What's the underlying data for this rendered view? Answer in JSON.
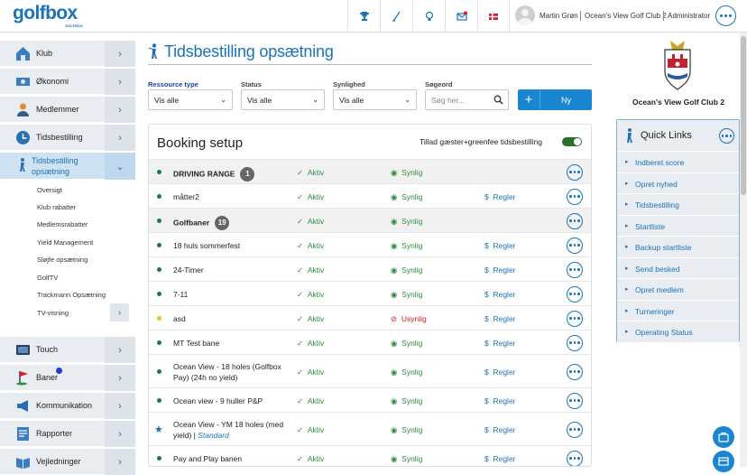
{
  "brand": {
    "logo_text": "golfbox",
    "logo_sub": "GOLFBOX"
  },
  "topbar": {
    "user_name": "Martin Grøn",
    "club": "Ocean's View Golf Club 2",
    "role": "Administrator",
    "icons": [
      "trophy-icon",
      "golf-club-icon",
      "lightbulb-icon",
      "mail-icon",
      "flag-dk-icon"
    ]
  },
  "sidebar": {
    "items": [
      {
        "label": "Klub",
        "icon": "house-icon"
      },
      {
        "label": "Økonomi",
        "icon": "money-icon"
      },
      {
        "label": "Medlemmer",
        "icon": "members-icon"
      },
      {
        "label": "Tidsbestilling",
        "icon": "clock-icon"
      },
      {
        "label": "Tidsbestilling opsætning",
        "icon": "golfer-icon"
      },
      {
        "label": "Touch",
        "icon": "touch-icon"
      },
      {
        "label": "Baner",
        "icon": "flag-icon"
      },
      {
        "label": "Kommunikation",
        "icon": "megaphone-icon"
      },
      {
        "label": "Rapporter",
        "icon": "report-icon"
      },
      {
        "label": "Vejledninger",
        "icon": "guide-icon"
      }
    ],
    "subitems": [
      "Oversigt",
      "Klub rabatter",
      "Medlemsrabatter",
      "Yield Management",
      "Sløjfe opsætning",
      "GolfTV",
      "Trackmann Opsætning",
      "TV-visning"
    ]
  },
  "page": {
    "title": "Tidsbestilling opsætning"
  },
  "filters": {
    "resource_label": "Ressource type",
    "resource_value": "Vis alle",
    "status_label": "Status",
    "status_value": "Vis alle",
    "visibility_label": "Synlighed",
    "visibility_value": "Vis alle",
    "search_label": "Søgeord",
    "search_placeholder": "Søg her...",
    "new_label": "Ny"
  },
  "panel": {
    "title": "Booking setup",
    "toggle_label": "Tillad gæster+greenfee tidsbestilling",
    "toggle_on": true
  },
  "rows": [
    {
      "name": "DRIVING RANGE",
      "count": "1",
      "group": true,
      "status": "Aktiv",
      "visibility": "Synlig",
      "rules": "",
      "marker": "green"
    },
    {
      "name": "måtter2",
      "group": false,
      "status": "Aktiv",
      "visibility": "Synlig",
      "rules": "Regler",
      "marker": "green"
    },
    {
      "name": "Golfbaner",
      "count": "19",
      "group": true,
      "status": "Aktiv",
      "visibility": "Synlig",
      "rules": "",
      "marker": "green"
    },
    {
      "name": "18 huls sommerfest",
      "group": false,
      "status": "Aktiv",
      "visibility": "Synlig",
      "rules": "Regler",
      "marker": "green"
    },
    {
      "name": "24-Timer",
      "group": false,
      "status": "Aktiv",
      "visibility": "Synlig",
      "rules": "Regler",
      "marker": "green"
    },
    {
      "name": "7-11",
      "group": false,
      "status": "Aktiv",
      "visibility": "Synlig",
      "rules": "Regler",
      "marker": "green"
    },
    {
      "name": "asd",
      "group": false,
      "status": "Aktiv",
      "visibility": "Usynlig",
      "rules": "Regler",
      "marker": "yellow"
    },
    {
      "name": "MT Test bane",
      "group": false,
      "status": "Aktiv",
      "visibility": "Synlig",
      "rules": "Regler",
      "marker": "green"
    },
    {
      "name": "Ocean View - 18 holes (Golfbox Pay) (24h no yield)",
      "group": false,
      "status": "Aktiv",
      "visibility": "Synlig",
      "rules": "Regler",
      "marker": "green"
    },
    {
      "name": "Ocean view - 9 huller P&P",
      "group": false,
      "status": "Aktiv",
      "visibility": "Synlig",
      "rules": "Regler",
      "marker": "green"
    },
    {
      "name": "Ocean View - YM 18 holes (med yield)",
      "tag": "Standard",
      "group": false,
      "status": "Aktiv",
      "visibility": "Synlig",
      "rules": "Regler",
      "marker": "star"
    },
    {
      "name": "Pay and Play banen",
      "group": false,
      "status": "Aktiv",
      "visibility": "Synlig",
      "rules": "Regler",
      "marker": "green"
    }
  ],
  "club_panel": {
    "name": "Ocean's View Golf Club 2"
  },
  "quick_links": {
    "title": "Quick Links",
    "items": [
      "Indberet score",
      "Opret nyhed",
      "Tidsbestilling",
      "Startliste",
      "Backup startliste",
      "Send besked",
      "Opret medlem",
      "Turneringer",
      "Operating Status"
    ]
  },
  "colors": {
    "accent": "#1a73b8",
    "active": "#2e8b3e",
    "invisible": "#cc2222",
    "toggle": "#2c6e2c"
  }
}
